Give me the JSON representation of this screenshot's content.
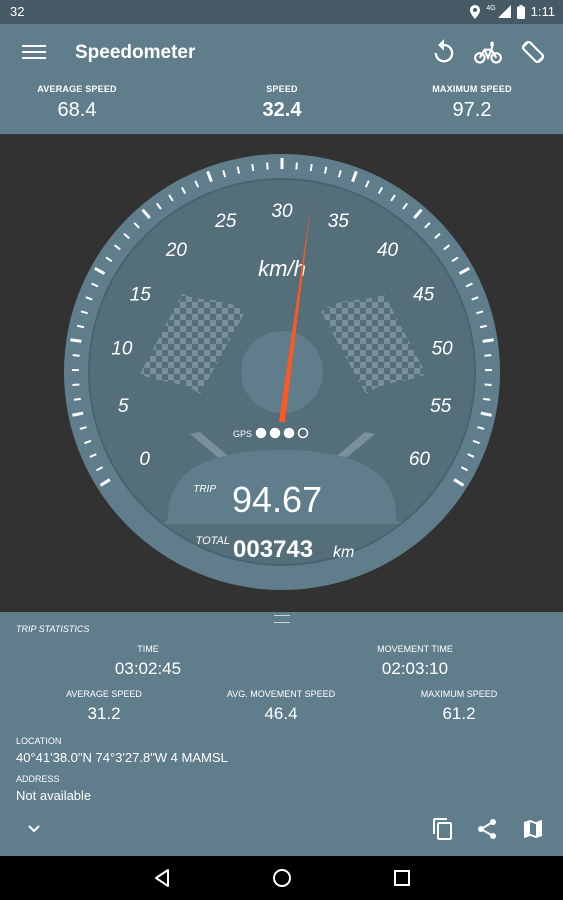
{
  "status_bar": {
    "left_text": "32",
    "time": "1:11",
    "network_label": "4G"
  },
  "app_bar": {
    "title": "Speedometer",
    "stats": [
      {
        "label": "AVERAGE SPEED",
        "value": "68.4"
      },
      {
        "label": "SPEED",
        "value": "32.4"
      },
      {
        "label": "MAXIMUM SPEED",
        "value": "97.2"
      }
    ],
    "actions": [
      "reset-icon",
      "bicycle-icon",
      "rotate-screen-icon"
    ]
  },
  "gauge": {
    "unit": "km/h",
    "min": 0,
    "max": 60,
    "current_speed": 32.4,
    "labels": [
      "0",
      "5",
      "10",
      "15",
      "20",
      "25",
      "30",
      "35",
      "40",
      "45",
      "50",
      "55",
      "60"
    ],
    "gps_label": "GPS",
    "gps_dots": [
      true,
      true,
      true,
      false
    ],
    "trip_label": "TRIP",
    "trip_value": "94.67",
    "total_label": "TOTAL",
    "total_value": "003743",
    "total_unit": "km",
    "colors": {
      "needle": "#ff5722",
      "face": "#546e7a",
      "rim": "#607d8b"
    }
  },
  "trip_statistics": {
    "title": "TRIP STATISTICS",
    "time_label": "TIME",
    "time_value": "03:02:45",
    "movement_time_label": "MOVEMENT TIME",
    "movement_time_value": "02:03:10",
    "avg_speed_label": "AVERAGE SPEED",
    "avg_speed_value": "31.2",
    "avg_movement_speed_label": "AVG. MOVEMENT SPEED",
    "avg_movement_speed_value": "46.4",
    "max_speed_label": "MAXIMUM SPEED",
    "max_speed_value": "61.2",
    "location_label": "LOCATION",
    "location_value": "40°41'38.0\"N 74°3'27.8\"W 4 MAMSL",
    "address_label": "ADDRESS",
    "address_value": "Not available"
  },
  "bottom_actions": [
    "collapse-icon",
    "copy-icon",
    "share-icon",
    "map-icon"
  ],
  "nav_bar": [
    "back-icon",
    "home-icon",
    "recents-icon"
  ]
}
